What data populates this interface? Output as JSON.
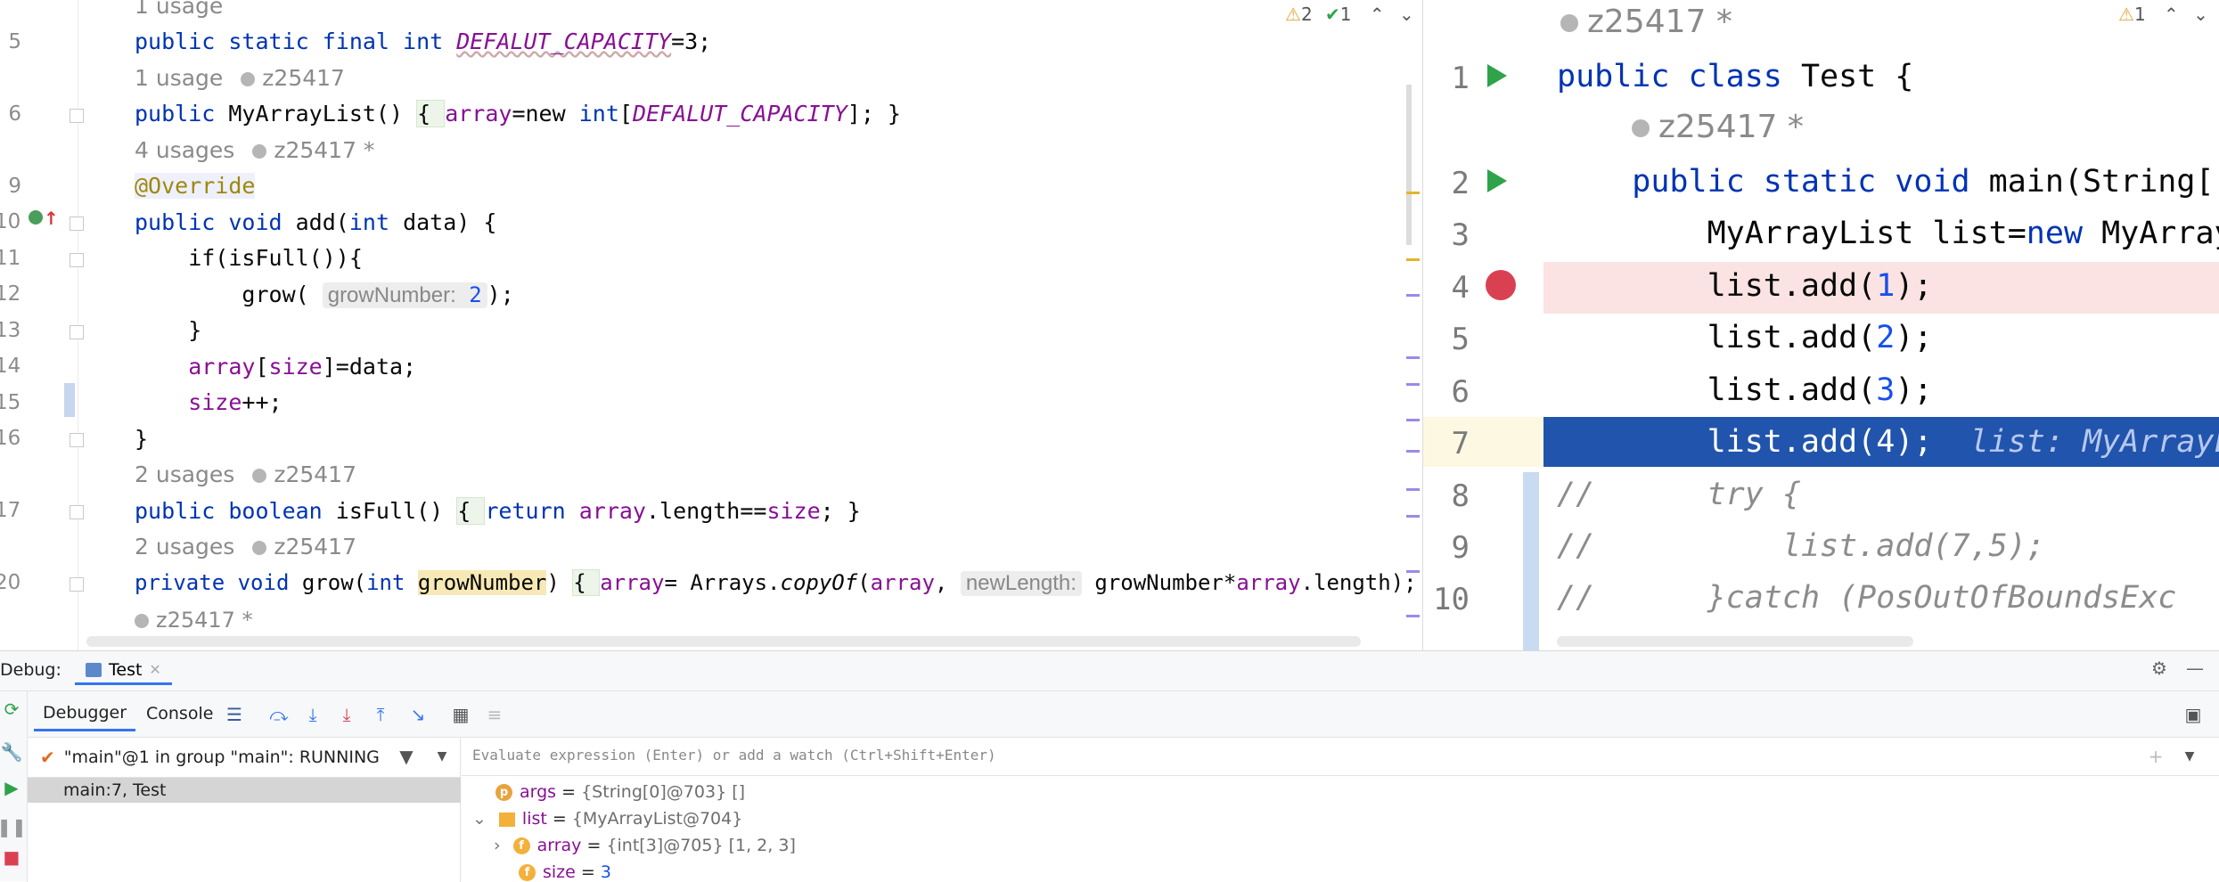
{
  "left_editor": {
    "inspections": {
      "warnings": "2",
      "checks": "1"
    },
    "lines": {
      "l5": "5",
      "l6": "6",
      "l9": "9",
      "l10": "10",
      "l11": "11",
      "l12": "12",
      "l13": "13",
      "l14": "14",
      "l15": "15",
      "l16": "16",
      "l17": "17",
      "l20": "20"
    },
    "hints": {
      "h0": "1 usage",
      "h1_usage": "1 usage",
      "h1_author": "z25417",
      "h2_usage": "4 usages",
      "h2_author": "z25417 *",
      "h3_usage": "2 usages",
      "h3_author": "z25417",
      "h4_usage": "2 usages",
      "h4_author": "z25417",
      "h5_author": "z25417 *"
    },
    "code": {
      "c5_a": "public static final int ",
      "c5_b": "DEFALUT_CAPACITY",
      "c5_c": "=3;",
      "c6_a": "public ",
      "c6_b": "MyArrayList() ",
      "c6_c": "{ ",
      "c6_d": "array",
      "c6_e": "=new ",
      "c6_f": "int",
      "c6_g": "[",
      "c6_h": "DEFALUT_CAPACITY",
      "c6_i": "]; }",
      "c9": "@Override",
      "c10_a": "public void ",
      "c10_b": "add(",
      "c10_c": "int ",
      "c10_d": "data) {",
      "c11": "    if(isFull()){",
      "c12_a": "        grow( ",
      "c12_b": "growNumber:",
      "c12_c": " 2",
      "c12_d": ");",
      "c13": "    }",
      "c14_a": "    array",
      "c14_b": "[",
      "c14_c": "size",
      "c14_d": "]=data;",
      "c15_a": "    size",
      "c15_b": "++;",
      "c16": "}",
      "c17_a": "public boolean ",
      "c17_b": "isFull() ",
      "c17_c": "{ ",
      "c17_d": "return ",
      "c17_e": "array",
      "c17_f": ".length==",
      "c17_g": "size",
      "c17_h": "; }",
      "c20_a": "private void ",
      "c20_b": "grow(",
      "c20_c": "int ",
      "c20_d": "growNumber",
      "c20_e": ") ",
      "c20_f": "{ ",
      "c20_g": "array",
      "c20_h": "= Arrays.",
      "c20_i": "copyOf",
      "c20_j": "(",
      "c20_k": "array",
      "c20_l": ", ",
      "c20_m": "newLength:",
      "c20_n": " growNumber*",
      "c20_o": "array",
      "c20_p": ".length); }"
    }
  },
  "right_editor": {
    "inspections": {
      "warnings": "1"
    },
    "hint_top": "z25417 *",
    "hint_mid": "z25417 *",
    "lines": {
      "r1": "1",
      "r2": "2",
      "r3": "3",
      "r4": "4",
      "r5": "5",
      "r6": "6",
      "r7": "7",
      "r8": "8",
      "r9": "9",
      "r10": "10"
    },
    "code": {
      "r1_a": "public class ",
      "r1_b": "Test {",
      "r2_a": "    public static void ",
      "r2_b": "main(String[]",
      "r3_a": "        MyArrayList list=",
      "r3_b": "new ",
      "r3_c": "MyArrayL",
      "r4_a": "        list.add(",
      "r4_b": "1",
      "r4_c": ");",
      "r5_a": "        list.add(",
      "r5_b": "2",
      "r5_c": ");",
      "r6_a": "        list.add(",
      "r6_b": "3",
      "r6_c": ");",
      "r7_a": "        list.add(4);",
      "r7_b": "  list: MyArrayL",
      "r8_a": "//",
      "r8_b": "      try {",
      "r9_a": "//",
      "r9_b": "          list.add(7,5);",
      "r10_a": "//",
      "r10_b": "      }catch (PosOutOfBoundsExc"
    }
  },
  "debug": {
    "title": "Debug:",
    "tab": "Test",
    "tab_debugger": "Debugger",
    "tab_console": "Console",
    "thread": "\"main\"@1 in group \"main\": RUNNING",
    "frame": "main:7, Test",
    "eval_placeholder": "Evaluate expression (Enter) or add a watch (Ctrl+Shift+Enter)",
    "vars": {
      "args_name": "args",
      "args_val": "{String[0]@703} []",
      "list_name": "list",
      "list_val": "{MyArrayList@704}",
      "array_name": "array",
      "array_val": "{int[3]@705} [1, 2, 3]",
      "size_name": "size",
      "size_val": "3"
    }
  }
}
